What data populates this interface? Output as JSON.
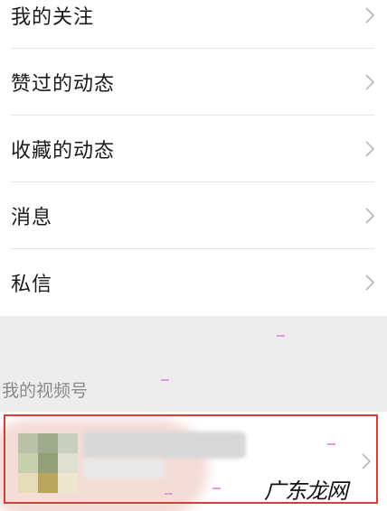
{
  "menu": {
    "items": [
      {
        "label": "我的关注"
      },
      {
        "label": "赞过的动态"
      },
      {
        "label": "收藏的动态"
      },
      {
        "label": "消息"
      },
      {
        "label": "私信"
      }
    ]
  },
  "channels_section": {
    "title": "我的视频号"
  },
  "watermark": {
    "text": "广东龙网"
  },
  "colors": {
    "highlight_border": "#d93b3b",
    "page_background": "#ededed",
    "card_background": "#ffffff"
  },
  "icons": {
    "row_chevron": "chevron-right-icon",
    "card_chevron": "chevron-right-icon"
  }
}
